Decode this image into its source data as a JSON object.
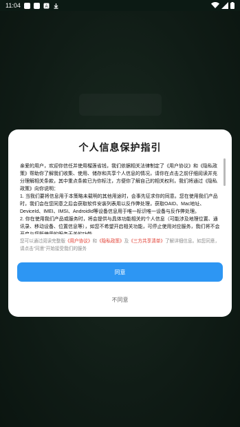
{
  "status_bar": {
    "time": "11:04"
  },
  "dialog": {
    "title": "个人信息保护指引",
    "paragraphs": [
      "亲爱的用户，欢迎你信任并使用榴莲省钱，我们依据相关法律制定了《用户协议》和《隐私政策》帮助你了解我们收集、使用、储存和共享个人信息的情况，请你在点击之前仔细阅读并充分理解相关条款，其中重点条款已为你标注，方便你了解自己的相关权利，我们将通过《隐私政策》向你说明：",
      "1. 当我们要将信息用于本策略未载明的其他用途时，会事先征求你的同意。您在使用我们产品时，我们会在您同意之后会获取软件安装列表用以反作弊处理，获取OAID、Mac地址、DeviceId、IMEI、IMSI、AndroidId等设备信息用于唯一标识唯一设备与反作弊处理。",
      "2. 你在使用我们产品或服务时，将会提供与具体功能相关的个人信息（可能涉及地理位置、通讯录、移动设备、位置信息等），如您不希望开启相关功能，可停止使用对应服务，我们将不会开启与您所使用的服务无关的功能。"
    ],
    "notice": {
      "prefix": "您可以通过阅读完整版",
      "link1": "《用户协议》",
      "and1": "和",
      "link2": "《隐私政策》",
      "and2": "及",
      "link3": "《三方共享清单》",
      "suffix": "了解详细信息。如您同意，请点击\"同意\"开始接受我们的服务"
    },
    "agree_label": "同意",
    "disagree_label": "不同意"
  }
}
